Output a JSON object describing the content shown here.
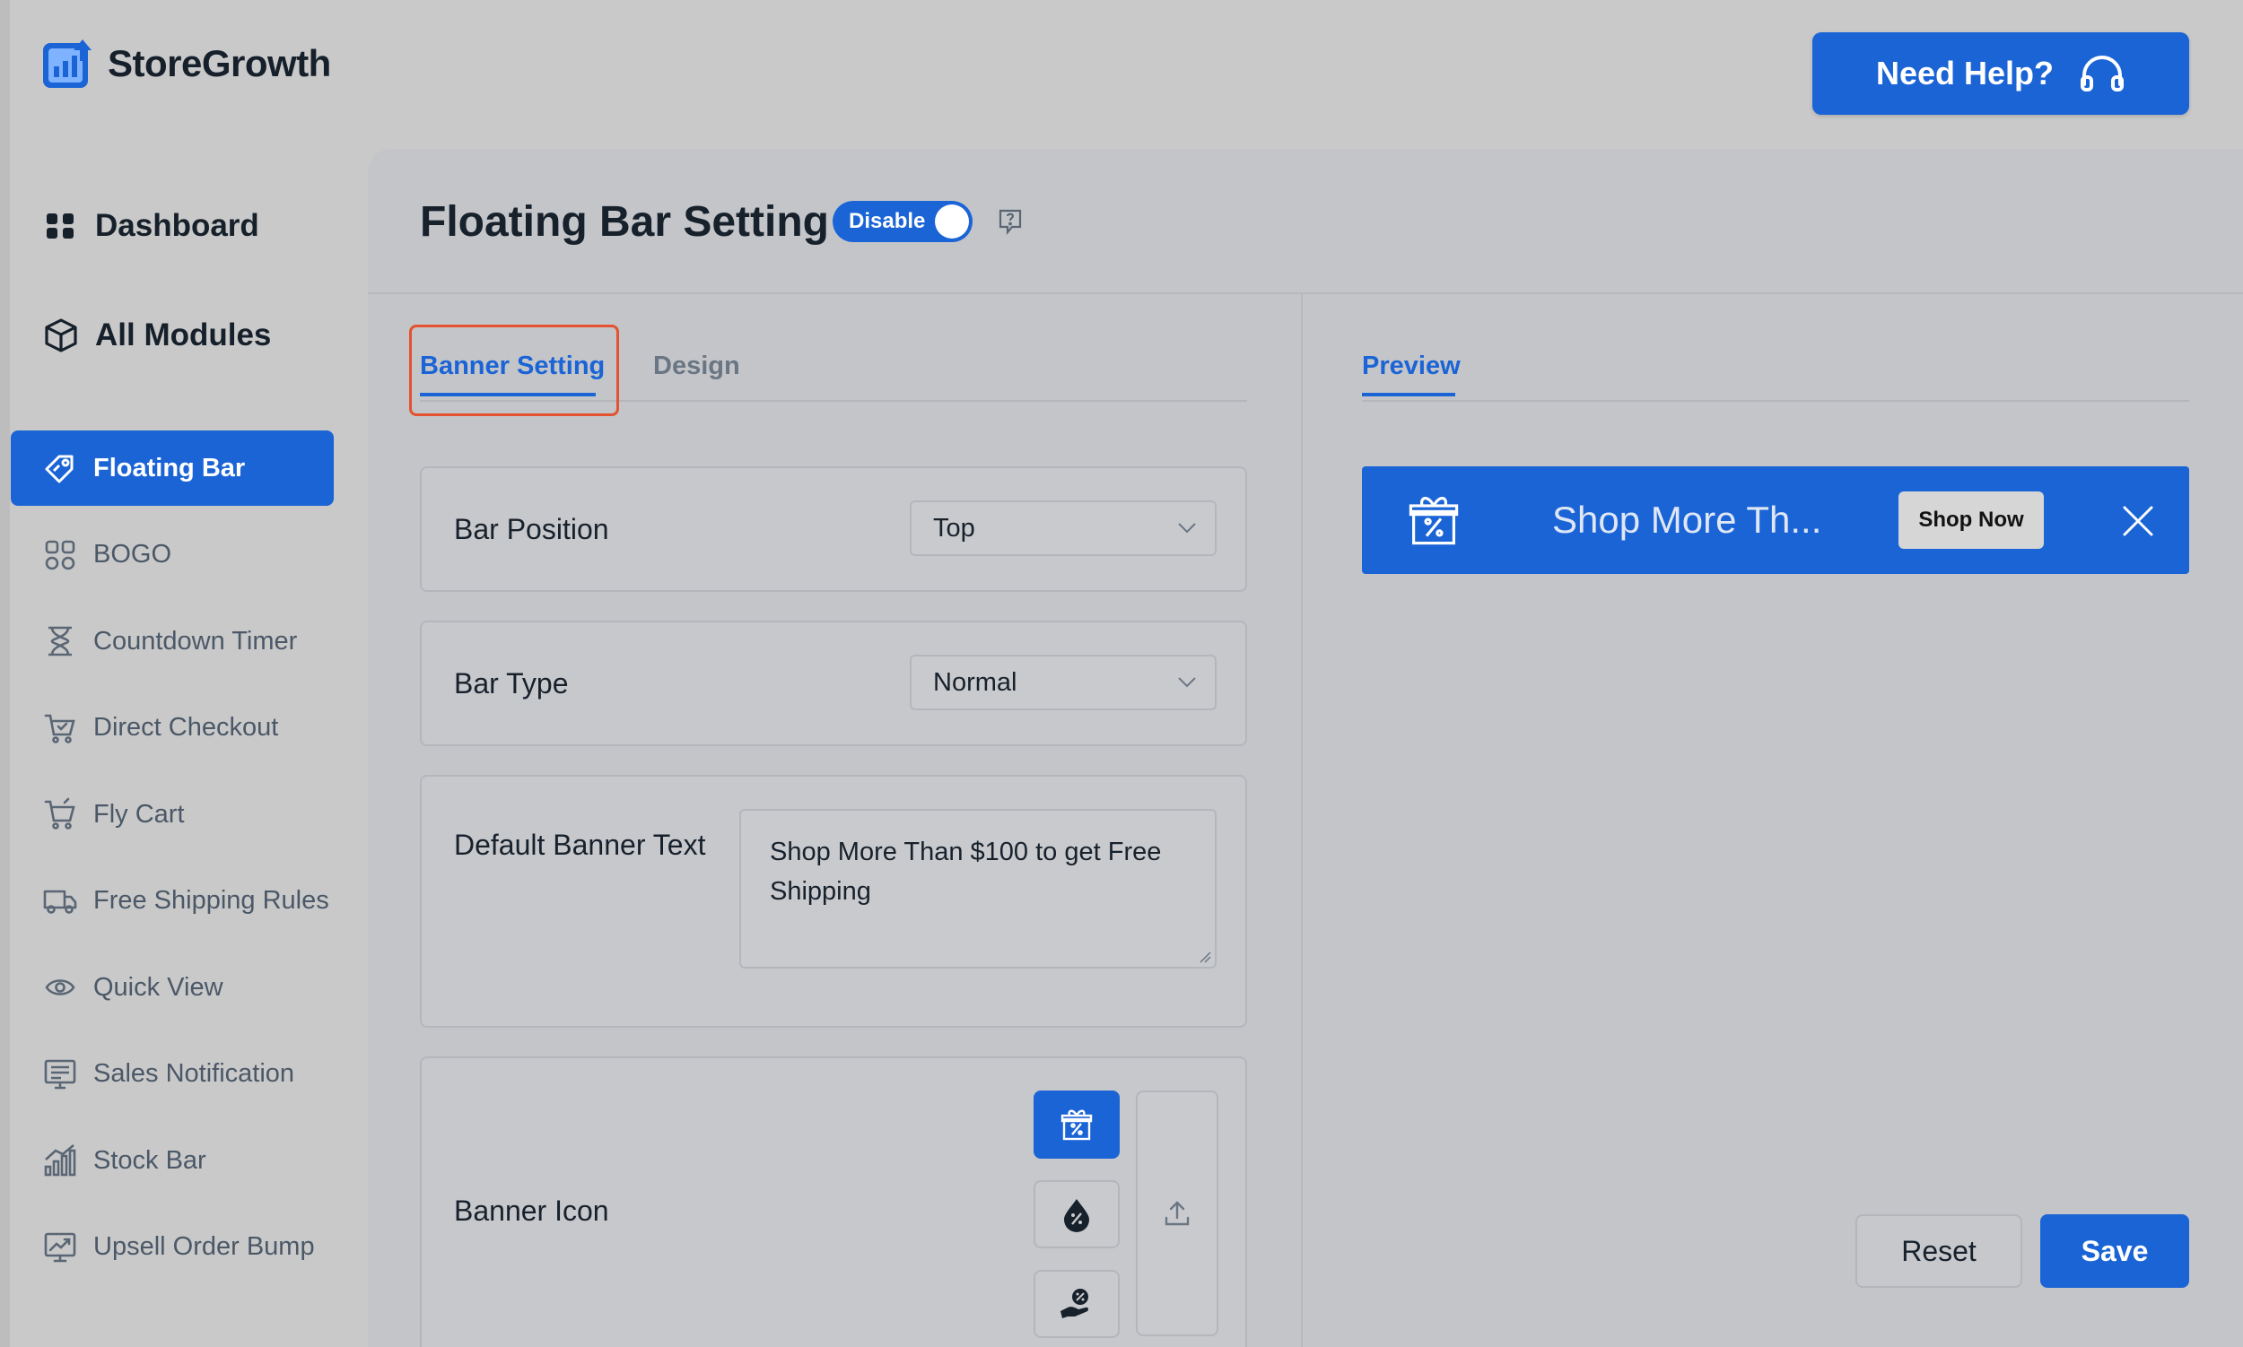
{
  "brand": {
    "name": "StoreGrowth",
    "logo_icon": "bar-chart-arrow-icon"
  },
  "header": {
    "help_label": "Need Help?",
    "help_icon": "headphones-icon"
  },
  "nav": {
    "dashboard": "Dashboard",
    "all_modules": "All Modules",
    "modules": [
      {
        "label": "Floating Bar",
        "icon": "tag-icon",
        "active": true
      },
      {
        "label": "BOGO",
        "icon": "bogo-icon"
      },
      {
        "label": "Countdown Timer",
        "icon": "hourglass-icon"
      },
      {
        "label": "Direct Checkout",
        "icon": "cart-check-icon"
      },
      {
        "label": "Fly Cart",
        "icon": "cart-icon"
      },
      {
        "label": "Free Shipping Rules",
        "icon": "truck-icon"
      },
      {
        "label": "Quick View",
        "icon": "eye-icon"
      },
      {
        "label": "Sales Notification",
        "icon": "notification-board-icon"
      },
      {
        "label": "Stock Bar",
        "icon": "stock-chart-icon"
      },
      {
        "label": "Upsell Order Bump",
        "icon": "trend-up-icon"
      }
    ]
  },
  "page": {
    "title": "Floating Bar Setting",
    "toggle_label": "Disable"
  },
  "tabs": {
    "banner": "Banner Setting",
    "design": "Design"
  },
  "fields": {
    "bar_position": {
      "label": "Bar Position",
      "value": "Top"
    },
    "bar_type": {
      "label": "Bar Type",
      "value": "Normal"
    },
    "banner_text": {
      "label": "Default Banner Text",
      "value": "Shop More Than $100 to get Free Shipping"
    },
    "banner_icon": {
      "label": "Banner Icon",
      "options": [
        "gift-percent-icon",
        "percent-drop-icon",
        "hand-coin-icon"
      ]
    }
  },
  "preview": {
    "tab": "Preview",
    "text": "Shop More Th...",
    "button": "Shop Now"
  },
  "actions": {
    "reset": "Reset",
    "save": "Save"
  },
  "colors": {
    "accent": "#1a64d6",
    "highlight": "#e4522f"
  }
}
